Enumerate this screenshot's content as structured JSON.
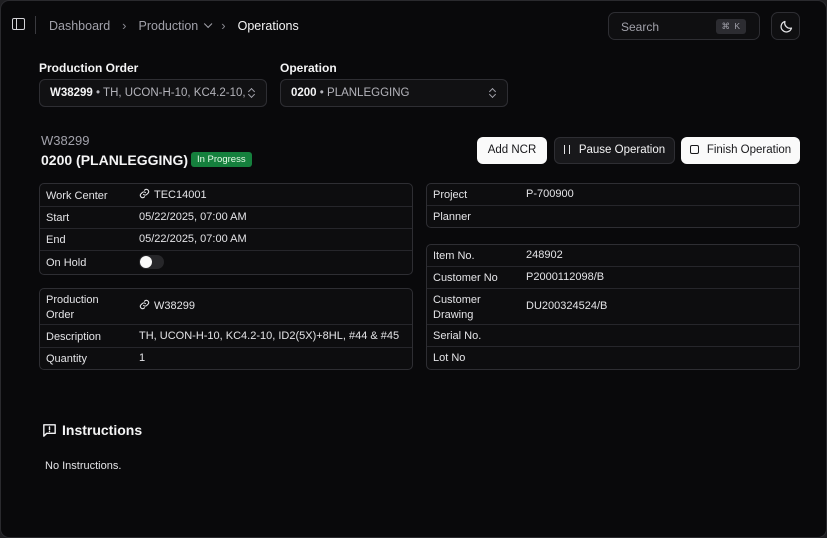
{
  "breadcrumb": {
    "items": [
      "Dashboard",
      "Production",
      "Operations"
    ]
  },
  "search": {
    "label": "Search",
    "shortcut": "⌘ K"
  },
  "selectors": {
    "production_order": {
      "label": "Production Order",
      "value_code": "W38299",
      "value_desc": "• TH, UCON-H-10, KC4.2-10,"
    },
    "operation": {
      "label": "Operation",
      "value_code": "0200",
      "value_desc": "• PLANLEGGING"
    }
  },
  "operation": {
    "order": "W38299",
    "title": "0200 (PLANLEGGING)",
    "status": "In Progress",
    "status_color": "#15803d"
  },
  "actions": {
    "add_ncr": "Add NCR",
    "pause": "Pause Operation",
    "finish": "Finish Operation"
  },
  "details_left_top": {
    "work_center_label": "Work Center",
    "work_center_value": "TEC14001",
    "start_label": "Start",
    "start_value": "05/22/2025, 07:00 AM",
    "end_label": "End",
    "end_value": "05/22/2025, 07:00 AM",
    "on_hold_label": "On Hold",
    "on_hold": false
  },
  "details_left_bottom": {
    "po_label_1": "Production",
    "po_label_2": "Order",
    "po_value": "W38299",
    "description_label": "Description",
    "description_value": "TH, UCON-H-10, KC4.2-10, ID2(5X)+8HL, #44 & #45",
    "quantity_label": "Quantity",
    "quantity_value": "1"
  },
  "details_right_top": {
    "project_label": "Project",
    "project_value": "P-700900",
    "planner_label": "Planner",
    "planner_value": ""
  },
  "details_right_bottom": {
    "item_label": "Item No.",
    "item_value": "248902",
    "customer_no_label": "Customer No",
    "customer_no_value": "P2000112098/B",
    "drawing_label_1": "Customer",
    "drawing_label_2": "Drawing",
    "drawing_value": "DU200324524/B",
    "serial_label": "Serial No.",
    "serial_value": "",
    "lot_label": "Lot No",
    "lot_value": ""
  },
  "instructions": {
    "title": "Instructions",
    "body": "No Instructions."
  },
  "colors": {
    "background": "#09090b",
    "primary_button": "#fafafa",
    "badge": "#15803d"
  }
}
